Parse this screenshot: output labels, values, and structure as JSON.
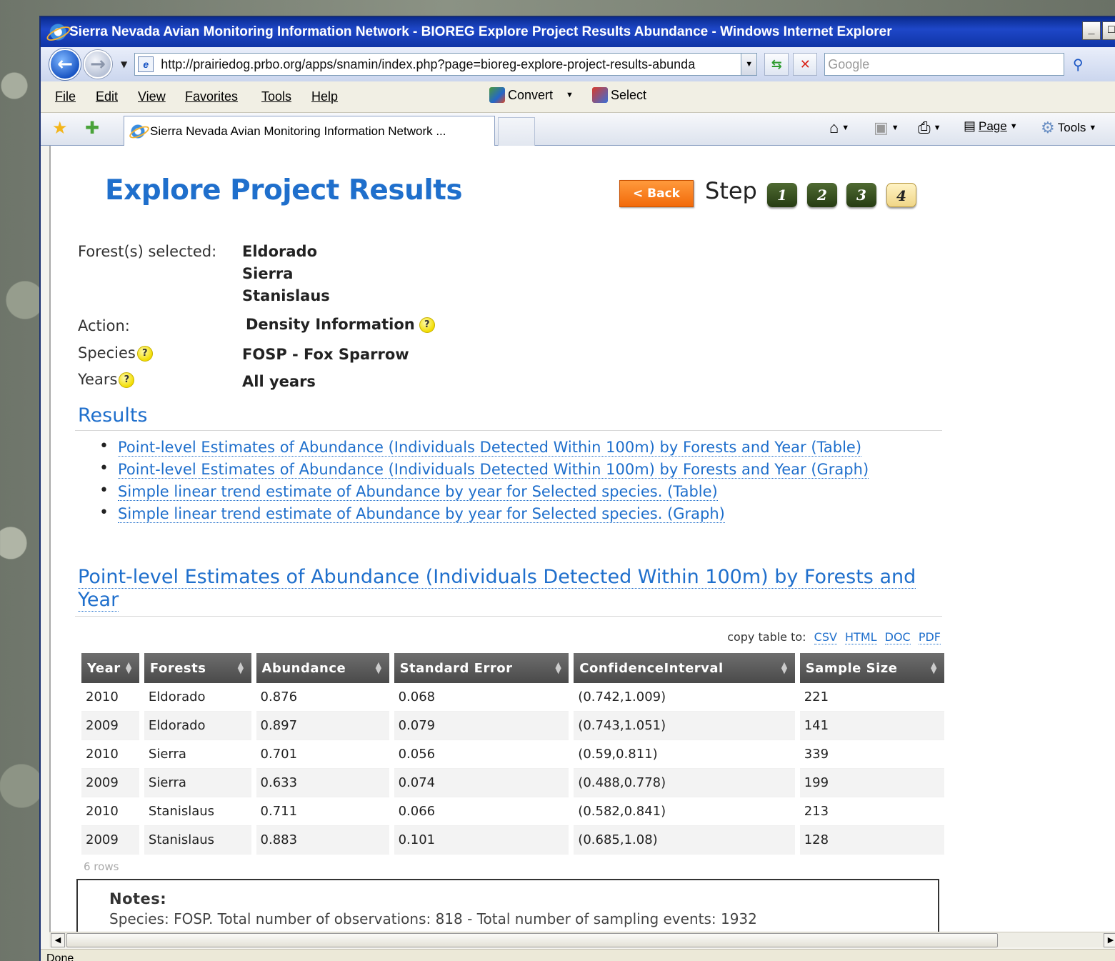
{
  "browser": {
    "window_title": "Sierra Nevada Avian Monitoring Information Network - BIOREG Explore Project Results Abundance - Windows Internet Explorer",
    "url": "http://prairiedog.prbo.org/apps/snamin/index.php?page=bioreg-explore-project-results-abunda",
    "search_placeholder": "Google",
    "menu": [
      "File",
      "Edit",
      "View",
      "Favorites",
      "Tools",
      "Help"
    ],
    "toolbar_convert": "Convert",
    "toolbar_select": "Select",
    "tab_title": "Sierra Nevada Avian Monitoring Information Network ...",
    "cmd_page": "Page",
    "cmd_tools": "Tools",
    "status_text": "Done"
  },
  "page": {
    "title": "Explore Project Results",
    "back_label": "< Back",
    "step_label": "Step",
    "steps": [
      "1",
      "2",
      "3",
      "4"
    ],
    "active_step": "4"
  },
  "selection": {
    "forest_label": "Forest(s) selected:",
    "forests": [
      "Eldorado",
      "Sierra",
      "Stanislaus"
    ],
    "action_label": "Action:",
    "action_value": "Density Information",
    "species_label": "Species",
    "species_value": "FOSP - Fox Sparrow",
    "years_label": "Years",
    "years_value": "All years"
  },
  "results": {
    "heading": "Results",
    "links": [
      "Point-level Estimates of Abundance (Individuals Detected Within 100m) by Forests and Year (Table)",
      "Point-level Estimates of Abundance (Individuals Detected Within 100m) by Forests and Year (Graph)",
      "Simple linear trend estimate of Abundance by year for Selected species. (Table)",
      "Simple linear trend estimate of Abundance by year for Selected species. (Graph)"
    ]
  },
  "table": {
    "title": "Point-level Estimates of Abundance (Individuals Detected Within 100m) by Forests and Year",
    "copy_label": "copy table to:",
    "copy_formats": [
      "CSV",
      "HTML",
      "DOC",
      "PDF"
    ],
    "columns": [
      "Year",
      "Forests",
      "Abundance",
      "Standard Error",
      "ConfidenceInterval",
      "Sample Size"
    ],
    "rows": [
      [
        "2010",
        "Eldorado",
        "0.876",
        "0.068",
        "(0.742,1.009)",
        "221"
      ],
      [
        "2009",
        "Eldorado",
        "0.897",
        "0.079",
        "(0.743,1.051)",
        "141"
      ],
      [
        "2010",
        "Sierra",
        "0.701",
        "0.056",
        "(0.59,0.811)",
        "339"
      ],
      [
        "2009",
        "Sierra",
        "0.633",
        "0.074",
        "(0.488,0.778)",
        "199"
      ],
      [
        "2010",
        "Stanislaus",
        "0.711",
        "0.066",
        "(0.582,0.841)",
        "213"
      ],
      [
        "2009",
        "Stanislaus",
        "0.883",
        "0.101",
        "(0.685,1.08)",
        "128"
      ]
    ],
    "row_count": "6 rows"
  },
  "notes": {
    "title": "Notes:",
    "text": "Species: FOSP. Total number of observations: 818 - Total number of sampling events: 1932"
  },
  "colors": {
    "accent": "#1f6fcc",
    "back_button": "#f26a0a",
    "title_bar": "#0a2b8f"
  },
  "icons": [
    "ie-logo-icon",
    "back-arrow-icon",
    "forward-arrow-icon",
    "refresh-icon",
    "stop-icon",
    "search-icon",
    "star-icon",
    "add-favorite-icon",
    "home-icon",
    "feeds-icon",
    "print-icon",
    "page-icon",
    "tools-gear-icon",
    "help-icon"
  ]
}
